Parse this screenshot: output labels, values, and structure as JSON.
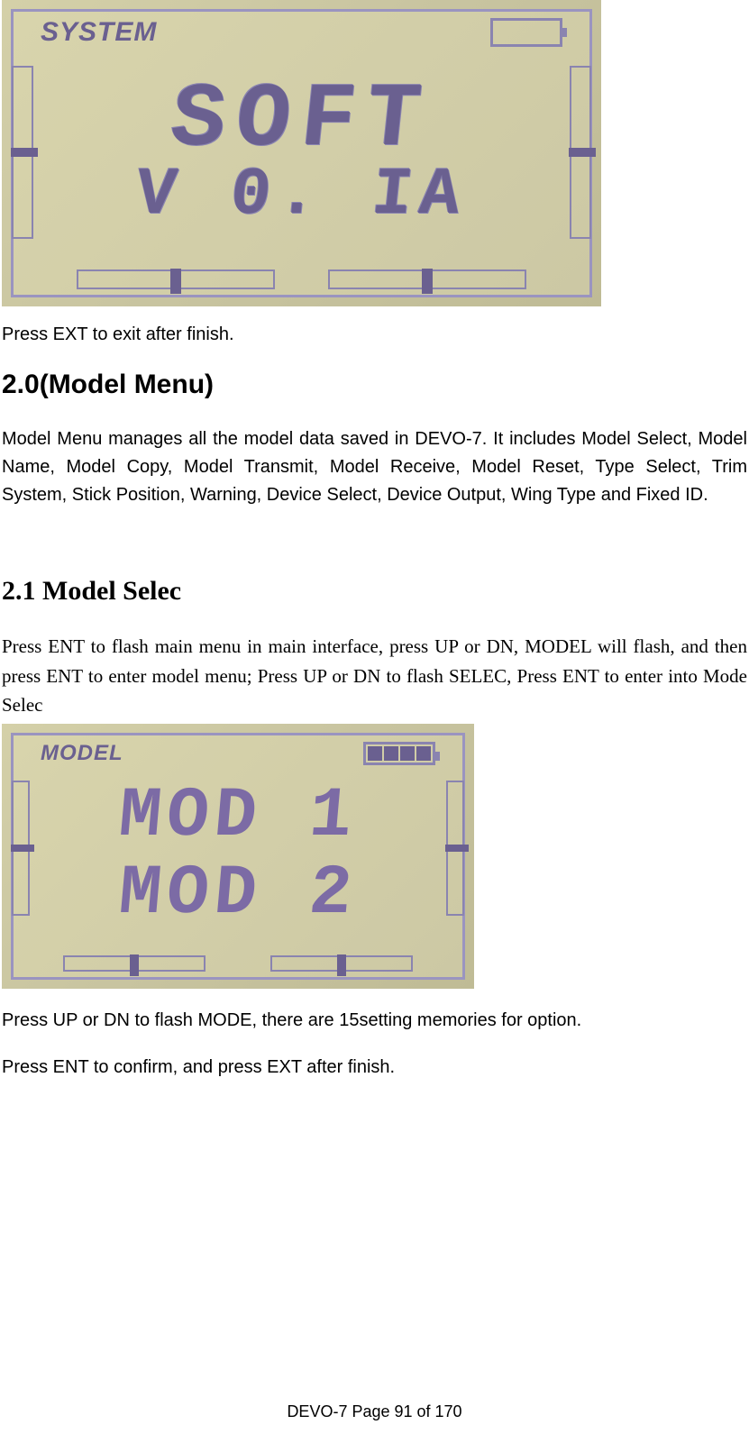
{
  "lcd1": {
    "header": "SYSTEM",
    "line1": "SOFT",
    "line2": "V 0. IA",
    "battery_segments": 0
  },
  "text1": "Press EXT to exit after finish.",
  "heading_model_menu": "2.0(Model Menu)",
  "paragraph_model_menu": "Model Menu manages all the model data saved in DEVO-7. It includes Model Select, Model Name, Model Copy, Model Transmit, Model Receive, Model Reset, Type Select, Trim System, Stick Position, Warning, Device Select, Device Output, Wing Type and Fixed ID.",
  "heading_model_selec": "2.1 Model Selec",
  "paragraph_model_selec": "Press ENT to flash main menu in main interface, press UP or DN, MODEL will flash, and then press ENT to enter model menu; Press UP or DN to flash SELEC, Press ENT to enter into Mode Selec",
  "lcd2": {
    "header": "MODEL",
    "line1": "MOD  1",
    "line2": "MOD  2",
    "battery_segments": 4
  },
  "text2": "Press UP or  DN to flash MODE, there are 15setting memories for option.",
  "text3": "Press ENT to confirm, and press EXT after finish.",
  "footer": "DEVO-7     Page 91 of 170"
}
